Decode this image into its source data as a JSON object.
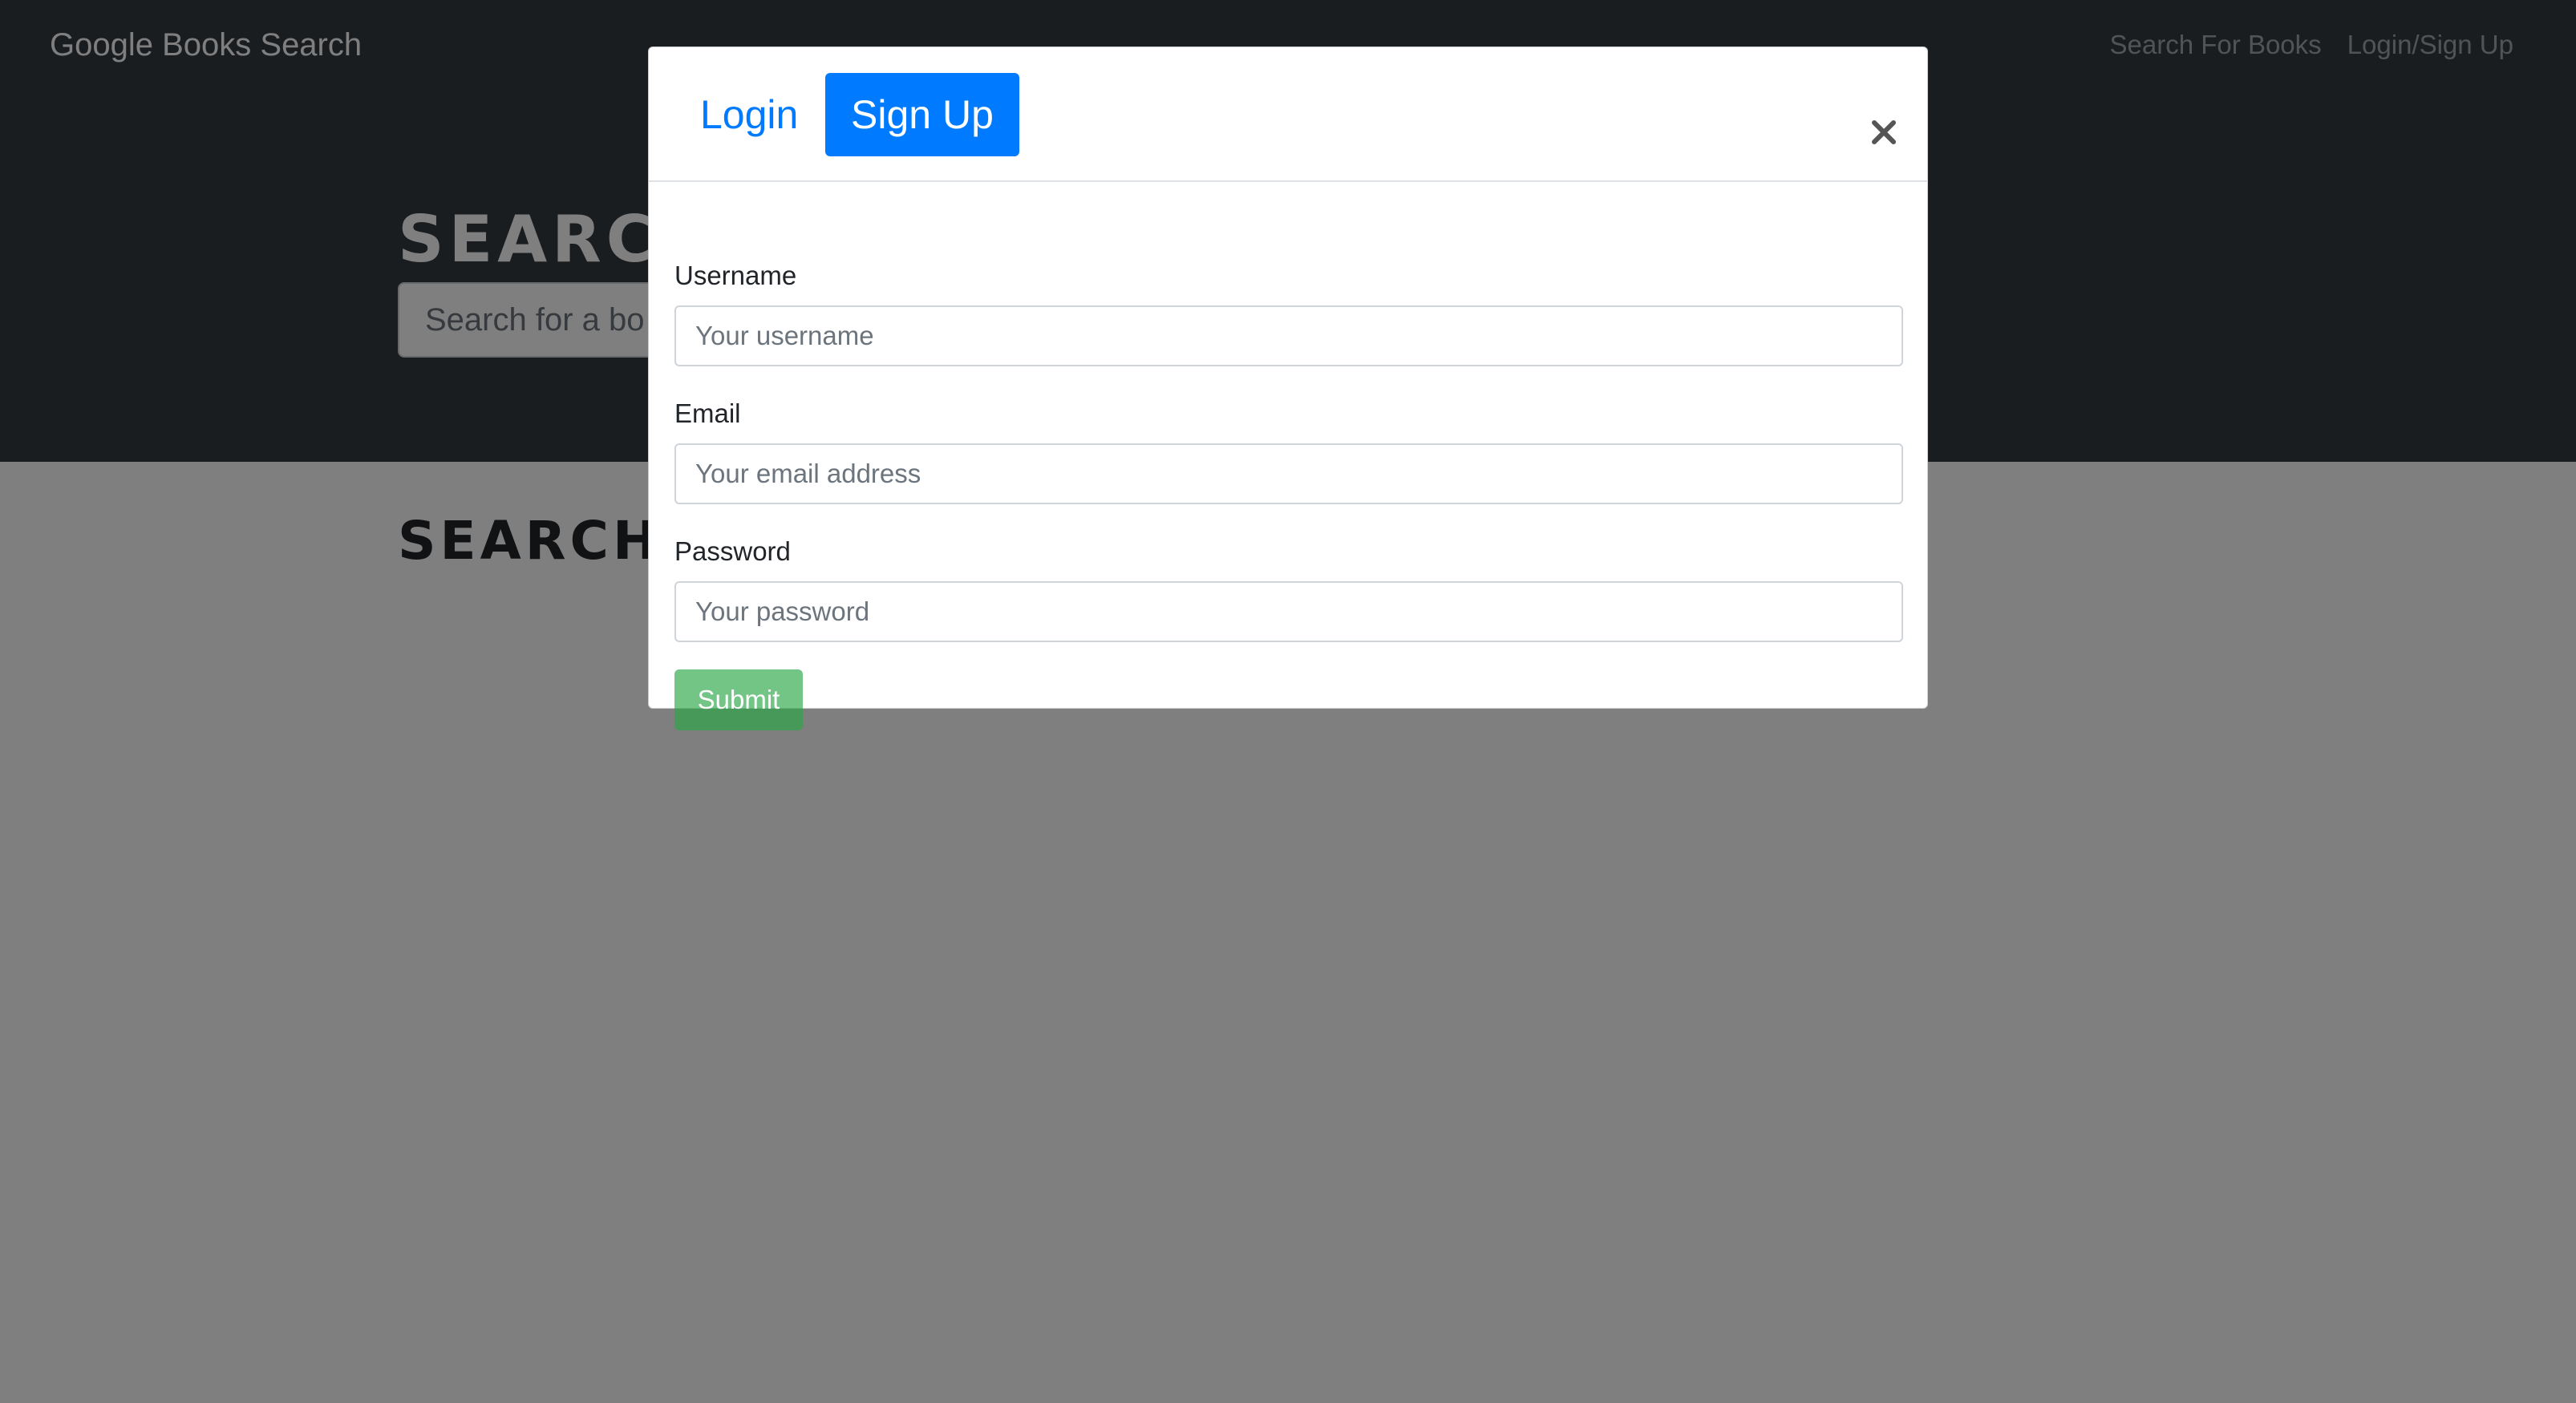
{
  "navbar": {
    "brand": "Google Books Search",
    "links": [
      {
        "label": "Search For Books"
      },
      {
        "label": "Login/Sign Up"
      }
    ]
  },
  "hero": {
    "title": "SEARCH",
    "search_placeholder": "Search for a bo"
  },
  "results": {
    "title": "SEARCH"
  },
  "modal": {
    "tabs": [
      {
        "label": "Login",
        "active": false
      },
      {
        "label": "Sign Up",
        "active": true
      }
    ],
    "close_icon": "close-icon",
    "fields": [
      {
        "label": "Username",
        "placeholder": "Your username"
      },
      {
        "label": "Email",
        "placeholder": "Your email address"
      },
      {
        "label": "Password",
        "placeholder": "Your password"
      }
    ],
    "submit_label": "Submit"
  },
  "colors": {
    "navbar_bg": "#343a40",
    "accent_blue": "#007bff",
    "submit_green": "#28a745",
    "backdrop": "rgba(0,0,0,0.5)"
  }
}
